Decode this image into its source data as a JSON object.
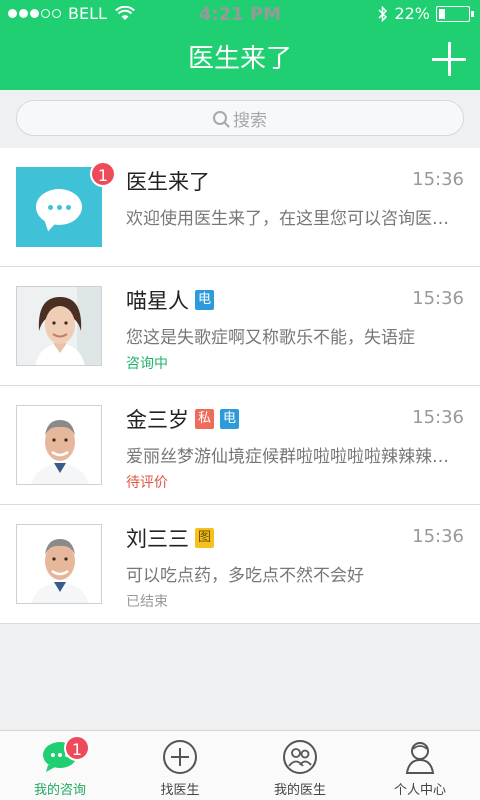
{
  "status_bar": {
    "carrier": "BELL",
    "time": "4:21 PM",
    "battery": "22%",
    "battery_level": 0.22
  },
  "nav": {
    "title": "医生来了"
  },
  "search": {
    "placeholder": "搜索"
  },
  "conversations": [
    {
      "name": "医生来了",
      "time": "15:36",
      "message": "欢迎使用医生来了，在这里您可以咨询医生的相关问题",
      "unread": "1",
      "tags": [],
      "status": ""
    },
    {
      "name": "喵星人",
      "time": "15:36",
      "message": "您这是失歌症啊又称歌乐不能，失语症",
      "tags": [
        "电"
      ],
      "status": "咨询中",
      "status_color": "#1fb36a"
    },
    {
      "name": "金三岁",
      "time": "15:36",
      "message": "爱丽丝梦游仙境症候群啦啦啦啦啦辣辣辣辣辣",
      "tags": [
        "私",
        "电"
      ],
      "status": "待评价",
      "status_color": "#e0573f"
    },
    {
      "name": "刘三三",
      "time": "15:36",
      "message": "可以吃点药，多吃点不然不会好",
      "tags": [
        "图"
      ],
      "status": "已结束",
      "status_color": "#999999"
    }
  ],
  "tabbar": {
    "tabs": [
      {
        "label": "我的咨询",
        "icon": "chat-bubble-icon",
        "active": true,
        "badge": "1"
      },
      {
        "label": "找医生",
        "icon": "plus-circle-icon"
      },
      {
        "label": "我的医生",
        "icon": "doctors-icon"
      },
      {
        "label": "个人中心",
        "icon": "person-icon"
      }
    ]
  },
  "colors": {
    "brand": "#1fcf72",
    "badge": "#ef4a5a",
    "system_avatar": "#3fc2d7"
  }
}
